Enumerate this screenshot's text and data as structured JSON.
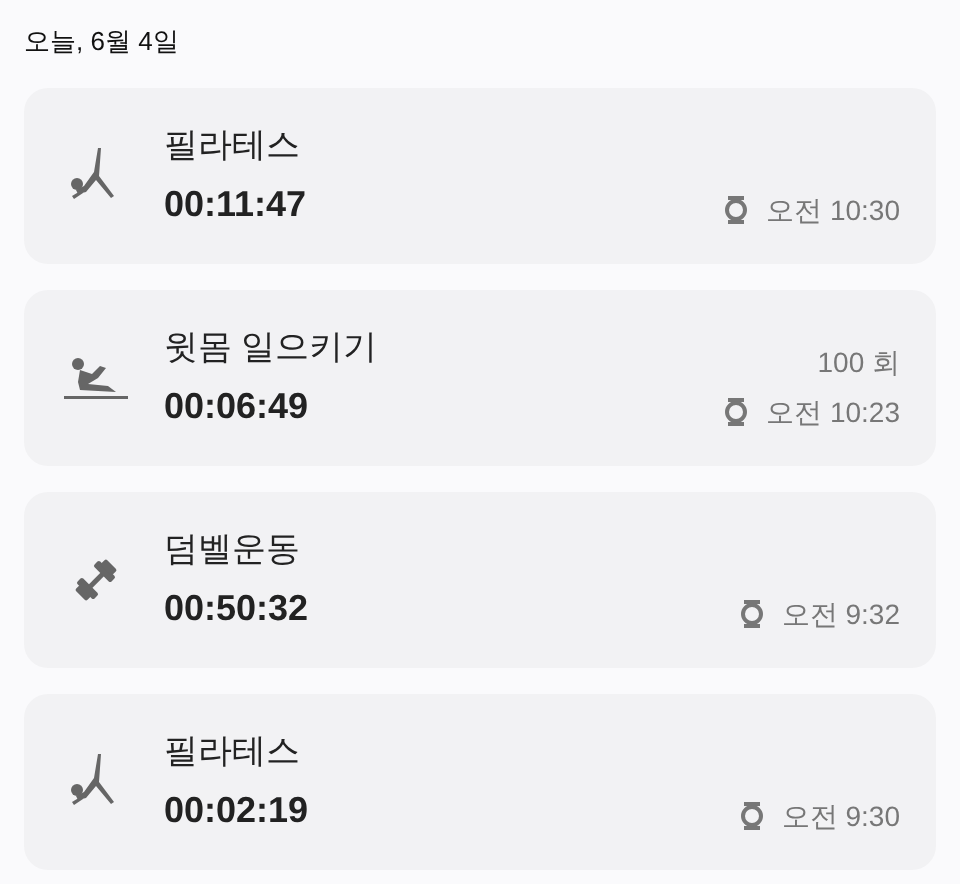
{
  "date_header": "오늘, 6월 4일",
  "workouts": [
    {
      "kind": "pilates",
      "name": "필라테스",
      "duration": "00:11:47",
      "time": "오전 10:30"
    },
    {
      "kind": "situp",
      "name": "윗몸 일으키기",
      "duration": "00:06:49",
      "count": "100 회",
      "time": "오전 10:23"
    },
    {
      "kind": "dumbbell",
      "name": "덤벨운동",
      "duration": "00:50:32",
      "time": "오전 9:32"
    },
    {
      "kind": "pilates",
      "name": "필라테스",
      "duration": "00:02:19",
      "time": "오전 9:30"
    }
  ]
}
